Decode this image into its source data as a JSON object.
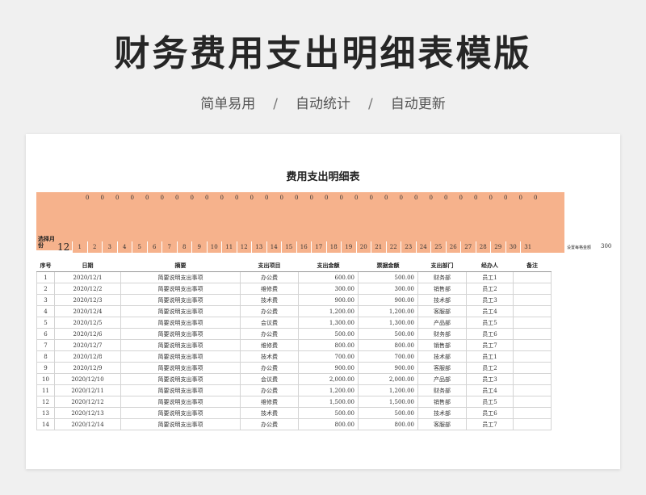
{
  "hero": {
    "title": "财务费用支出明细表模版",
    "tags": [
      "简单易用",
      "自动统计",
      "自动更新"
    ],
    "separator": "/"
  },
  "sheet": {
    "title": "费用支出明细表",
    "select_label": "选择月份",
    "selected_month": "12",
    "daily_totals": [
      "0",
      "0",
      "0",
      "0",
      "0",
      "0",
      "0",
      "0",
      "0",
      "0",
      "0",
      "0",
      "0",
      "0",
      "0",
      "0",
      "0",
      "0",
      "0",
      "0",
      "0",
      "0",
      "0",
      "0",
      "0",
      "0",
      "0",
      "0",
      "0",
      "0",
      "0"
    ],
    "days": [
      "1",
      "2",
      "3",
      "4",
      "5",
      "6",
      "7",
      "8",
      "9",
      "10",
      "11",
      "12",
      "13",
      "14",
      "15",
      "16",
      "17",
      "18",
      "19",
      "20",
      "21",
      "22",
      "23",
      "24",
      "25",
      "26",
      "27",
      "28",
      "29",
      "30",
      "31"
    ],
    "setting_label": "设置每格金额",
    "setting_value": "300"
  },
  "table": {
    "headers": [
      "序号",
      "日期",
      "摘要",
      "支出项目",
      "支出金额",
      "票据金额",
      "支出部门",
      "经办人",
      "备注"
    ],
    "rows": [
      [
        "1",
        "2020/12/1",
        "简要说明支出事项",
        "办公费",
        "600.00",
        "500.00",
        "财务部",
        "员工1",
        ""
      ],
      [
        "2",
        "2020/12/2",
        "简要说明支出事项",
        "维修费",
        "300.00",
        "300.00",
        "销售部",
        "员工2",
        ""
      ],
      [
        "3",
        "2020/12/3",
        "简要说明支出事项",
        "技术费",
        "900.00",
        "900.00",
        "技术部",
        "员工3",
        ""
      ],
      [
        "4",
        "2020/12/4",
        "简要说明支出事项",
        "办公费",
        "1,200.00",
        "1,200.00",
        "客服部",
        "员工4",
        ""
      ],
      [
        "5",
        "2020/12/5",
        "简要说明支出事项",
        "会议费",
        "1,300.00",
        "1,300.00",
        "产品部",
        "员工5",
        ""
      ],
      [
        "6",
        "2020/12/6",
        "简要说明支出事项",
        "办公费",
        "500.00",
        "500.00",
        "财务部",
        "员工6",
        ""
      ],
      [
        "7",
        "2020/12/7",
        "简要说明支出事项",
        "维修费",
        "800.00",
        "800.00",
        "销售部",
        "员工7",
        ""
      ],
      [
        "8",
        "2020/12/8",
        "简要说明支出事项",
        "技术费",
        "700.00",
        "700.00",
        "技术部",
        "员工1",
        ""
      ],
      [
        "9",
        "2020/12/9",
        "简要说明支出事项",
        "办公费",
        "900.00",
        "900.00",
        "客服部",
        "员工2",
        ""
      ],
      [
        "10",
        "2020/12/10",
        "简要说明支出事项",
        "会议费",
        "2,000.00",
        "2,000.00",
        "产品部",
        "员工3",
        ""
      ],
      [
        "11",
        "2020/12/11",
        "简要说明支出事项",
        "办公费",
        "1,200.00",
        "1,200.00",
        "财务部",
        "员工4",
        ""
      ],
      [
        "12",
        "2020/12/12",
        "简要说明支出事项",
        "维修费",
        "1,500.00",
        "1,500.00",
        "销售部",
        "员工5",
        ""
      ],
      [
        "13",
        "2020/12/13",
        "简要说明支出事项",
        "技术费",
        "500.00",
        "500.00",
        "技术部",
        "员工6",
        ""
      ],
      [
        "14",
        "2020/12/14",
        "简要说明支出事项",
        "办公费",
        "800.00",
        "800.00",
        "客服部",
        "员工7",
        ""
      ]
    ]
  }
}
